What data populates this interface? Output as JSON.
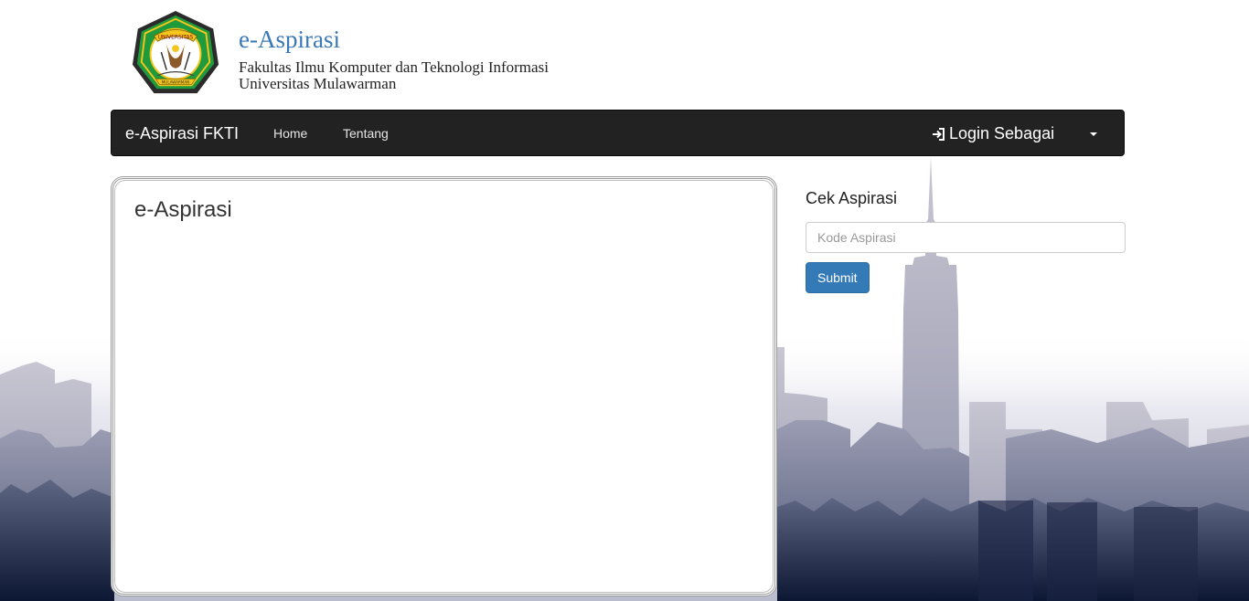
{
  "header": {
    "title": "e-Aspirasi",
    "subtitle_line1": "Fakultas Ilmu Komputer dan Teknologi Informasi",
    "subtitle_line2": "Universitas Mulawarman",
    "logo_icon": "university-crest-logo",
    "logo_banner_top": "UNIVERSITAS",
    "logo_banner_bottom": "MULAWARMAN"
  },
  "navbar": {
    "brand": "e-Aspirasi FKTI",
    "links": [
      "Home",
      "Tentang"
    ],
    "login_label": "Login Sebagai",
    "login_icon": "sign-in-icon",
    "caret_icon": "caret-down-icon"
  },
  "main": {
    "panel_title": "e-Aspirasi"
  },
  "sidebar": {
    "title": "Cek Aspirasi",
    "input_placeholder": "Kode Aspirasi",
    "input_value": "",
    "submit_label": "Submit"
  },
  "colors": {
    "navbar_bg": "#222222",
    "brand_blue": "#3a78b8",
    "button_blue": "#337ab7",
    "logo_green": "#1f9a3c",
    "logo_yellow": "#f4c51c"
  }
}
